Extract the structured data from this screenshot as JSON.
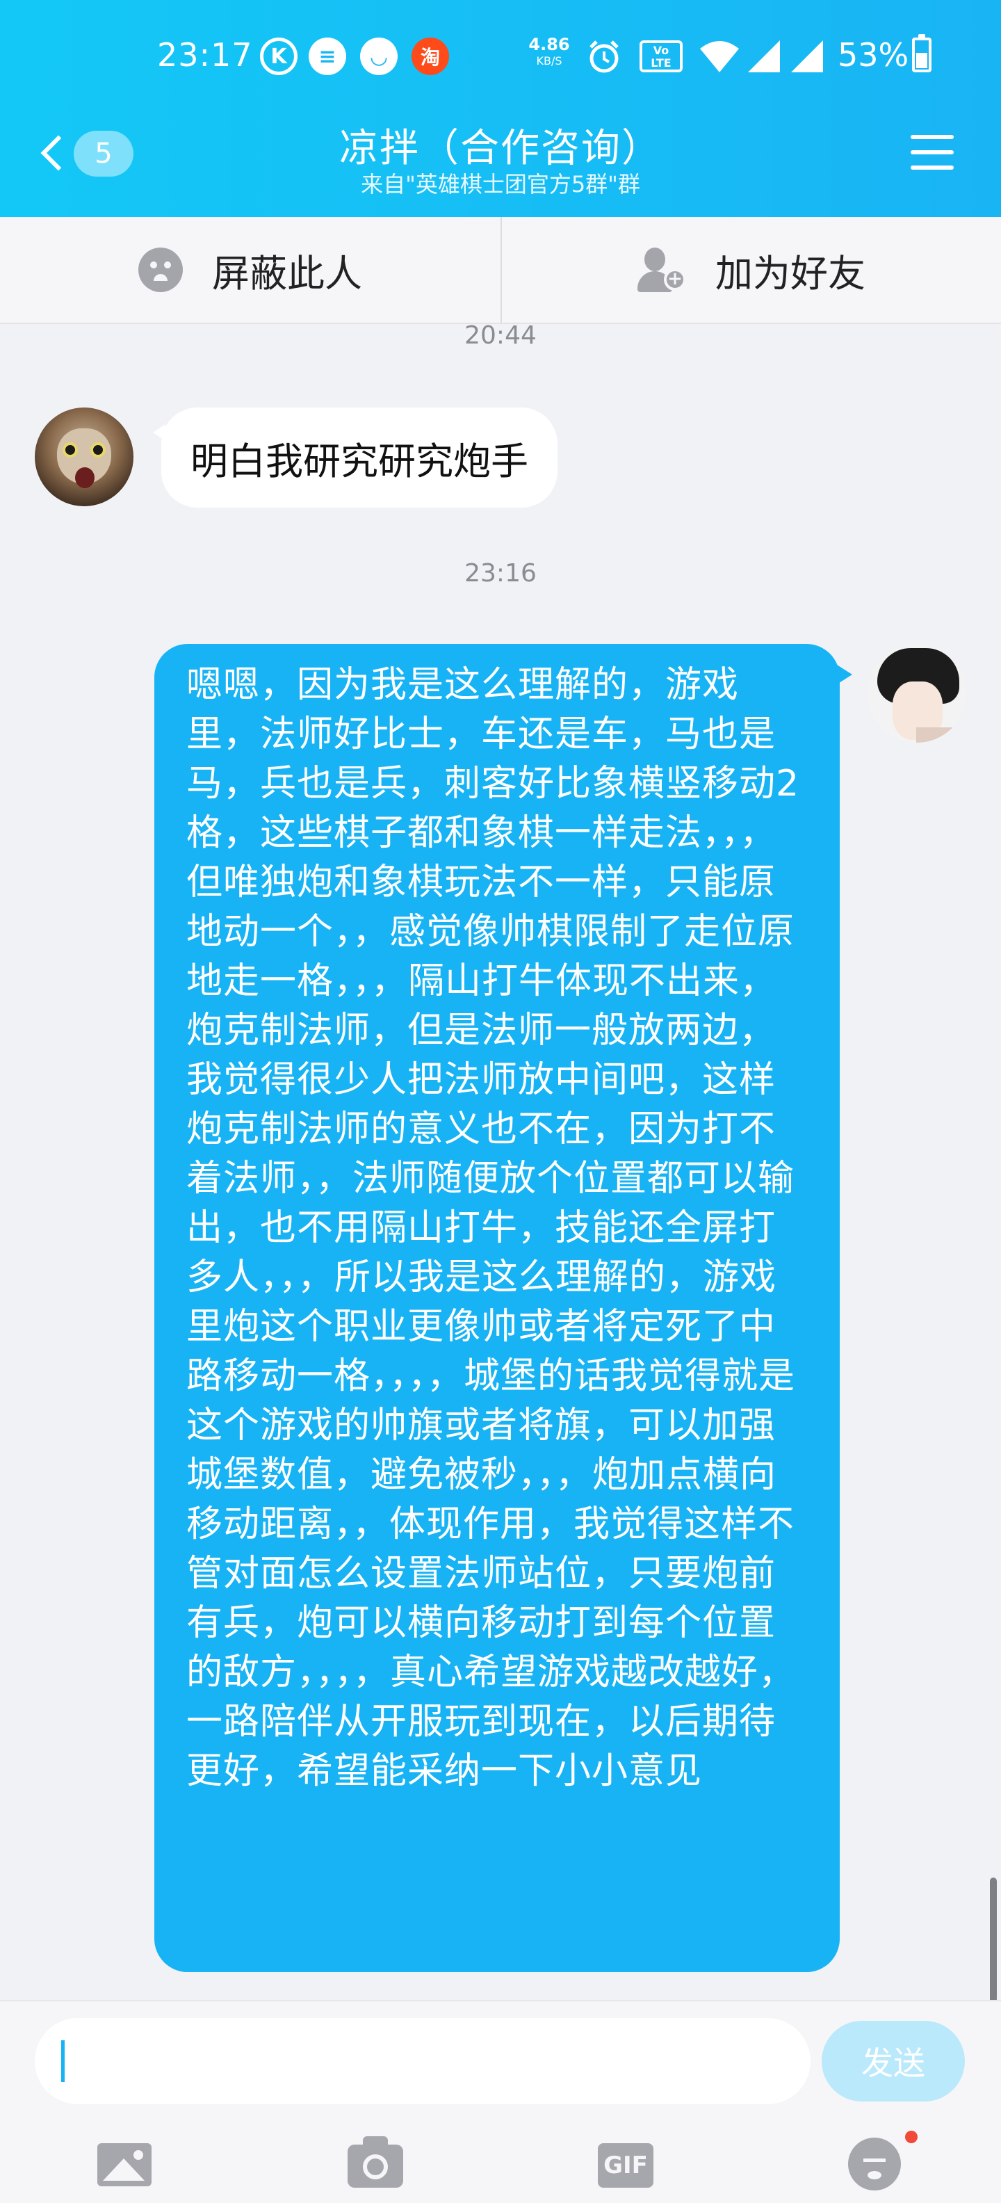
{
  "status_bar": {
    "time": "23:17",
    "icons": [
      "k-icon",
      "message-bubble-icon",
      "smile-icon",
      "taobao-icon"
    ],
    "taobao_label": "淘",
    "k_label": "K",
    "network_speed": "4.86",
    "network_unit": "KB/S",
    "volte_label": "Vo LTE",
    "battery_percent": "53%",
    "battery_level": 0.53
  },
  "header": {
    "back_count": "5",
    "title": "凉拌（合作咨询）",
    "subtitle": "来自\"英雄棋士团官方5群\"群"
  },
  "actions": {
    "block_label": "屏蔽此人",
    "add_friend_label": "加为好友"
  },
  "chat": {
    "messages": [
      {
        "type": "timestamp",
        "text": "20:44"
      },
      {
        "type": "incoming",
        "text": "明白我研究研究炮手"
      },
      {
        "type": "timestamp",
        "text": "23:16"
      },
      {
        "type": "outgoing",
        "text": "嗯嗯，因为我是这么理解的，游戏里，法师好比士，车还是车，马也是马，兵也是兵，刺客好比象横竖移动2格，这些棋子都和象棋一样走法，，，但唯独炮和象棋玩法不一样，只能原地动一个，，感觉像帅棋限制了走位原地走一格，，，隔山打牛体现不出来，炮克制法师，但是法师一般放两边，我觉得很少人把法师放中间吧，这样炮克制法师的意义也不在，因为打不着法师，，法师随便放个位置都可以输出，也不用隔山打牛，技能还全屏打多人，，，所以我是这么理解的，游戏里炮这个职业更像帅或者将定死了中路移动一格，，，，城堡的话我觉得就是这个游戏的帅旗或者将旗，可以加强城堡数值，避免被秒，，，炮加点横向移动距离，，体现作用，我觉得这样不管对面怎么设置法师站位，只要炮前有兵，炮可以横向移动打到每个位置的敌方，，，，真心希望游戏越改越好，一路陪伴从开服玩到现在，以后期待更好，希望能采纳一下小小意见"
      }
    ]
  },
  "input": {
    "value": "",
    "send_label": "发送",
    "gif_label": "GIF",
    "toolbar_icons": [
      "image-icon",
      "camera-icon",
      "gif-icon",
      "emoji-icon"
    ]
  },
  "colors": {
    "header_start": "#13c8f6",
    "header_end": "#19b4f4",
    "outgoing_bubble": "#18b3f4",
    "send_disabled": "#b9e9fb",
    "notification_dot": "#f14a3a"
  }
}
